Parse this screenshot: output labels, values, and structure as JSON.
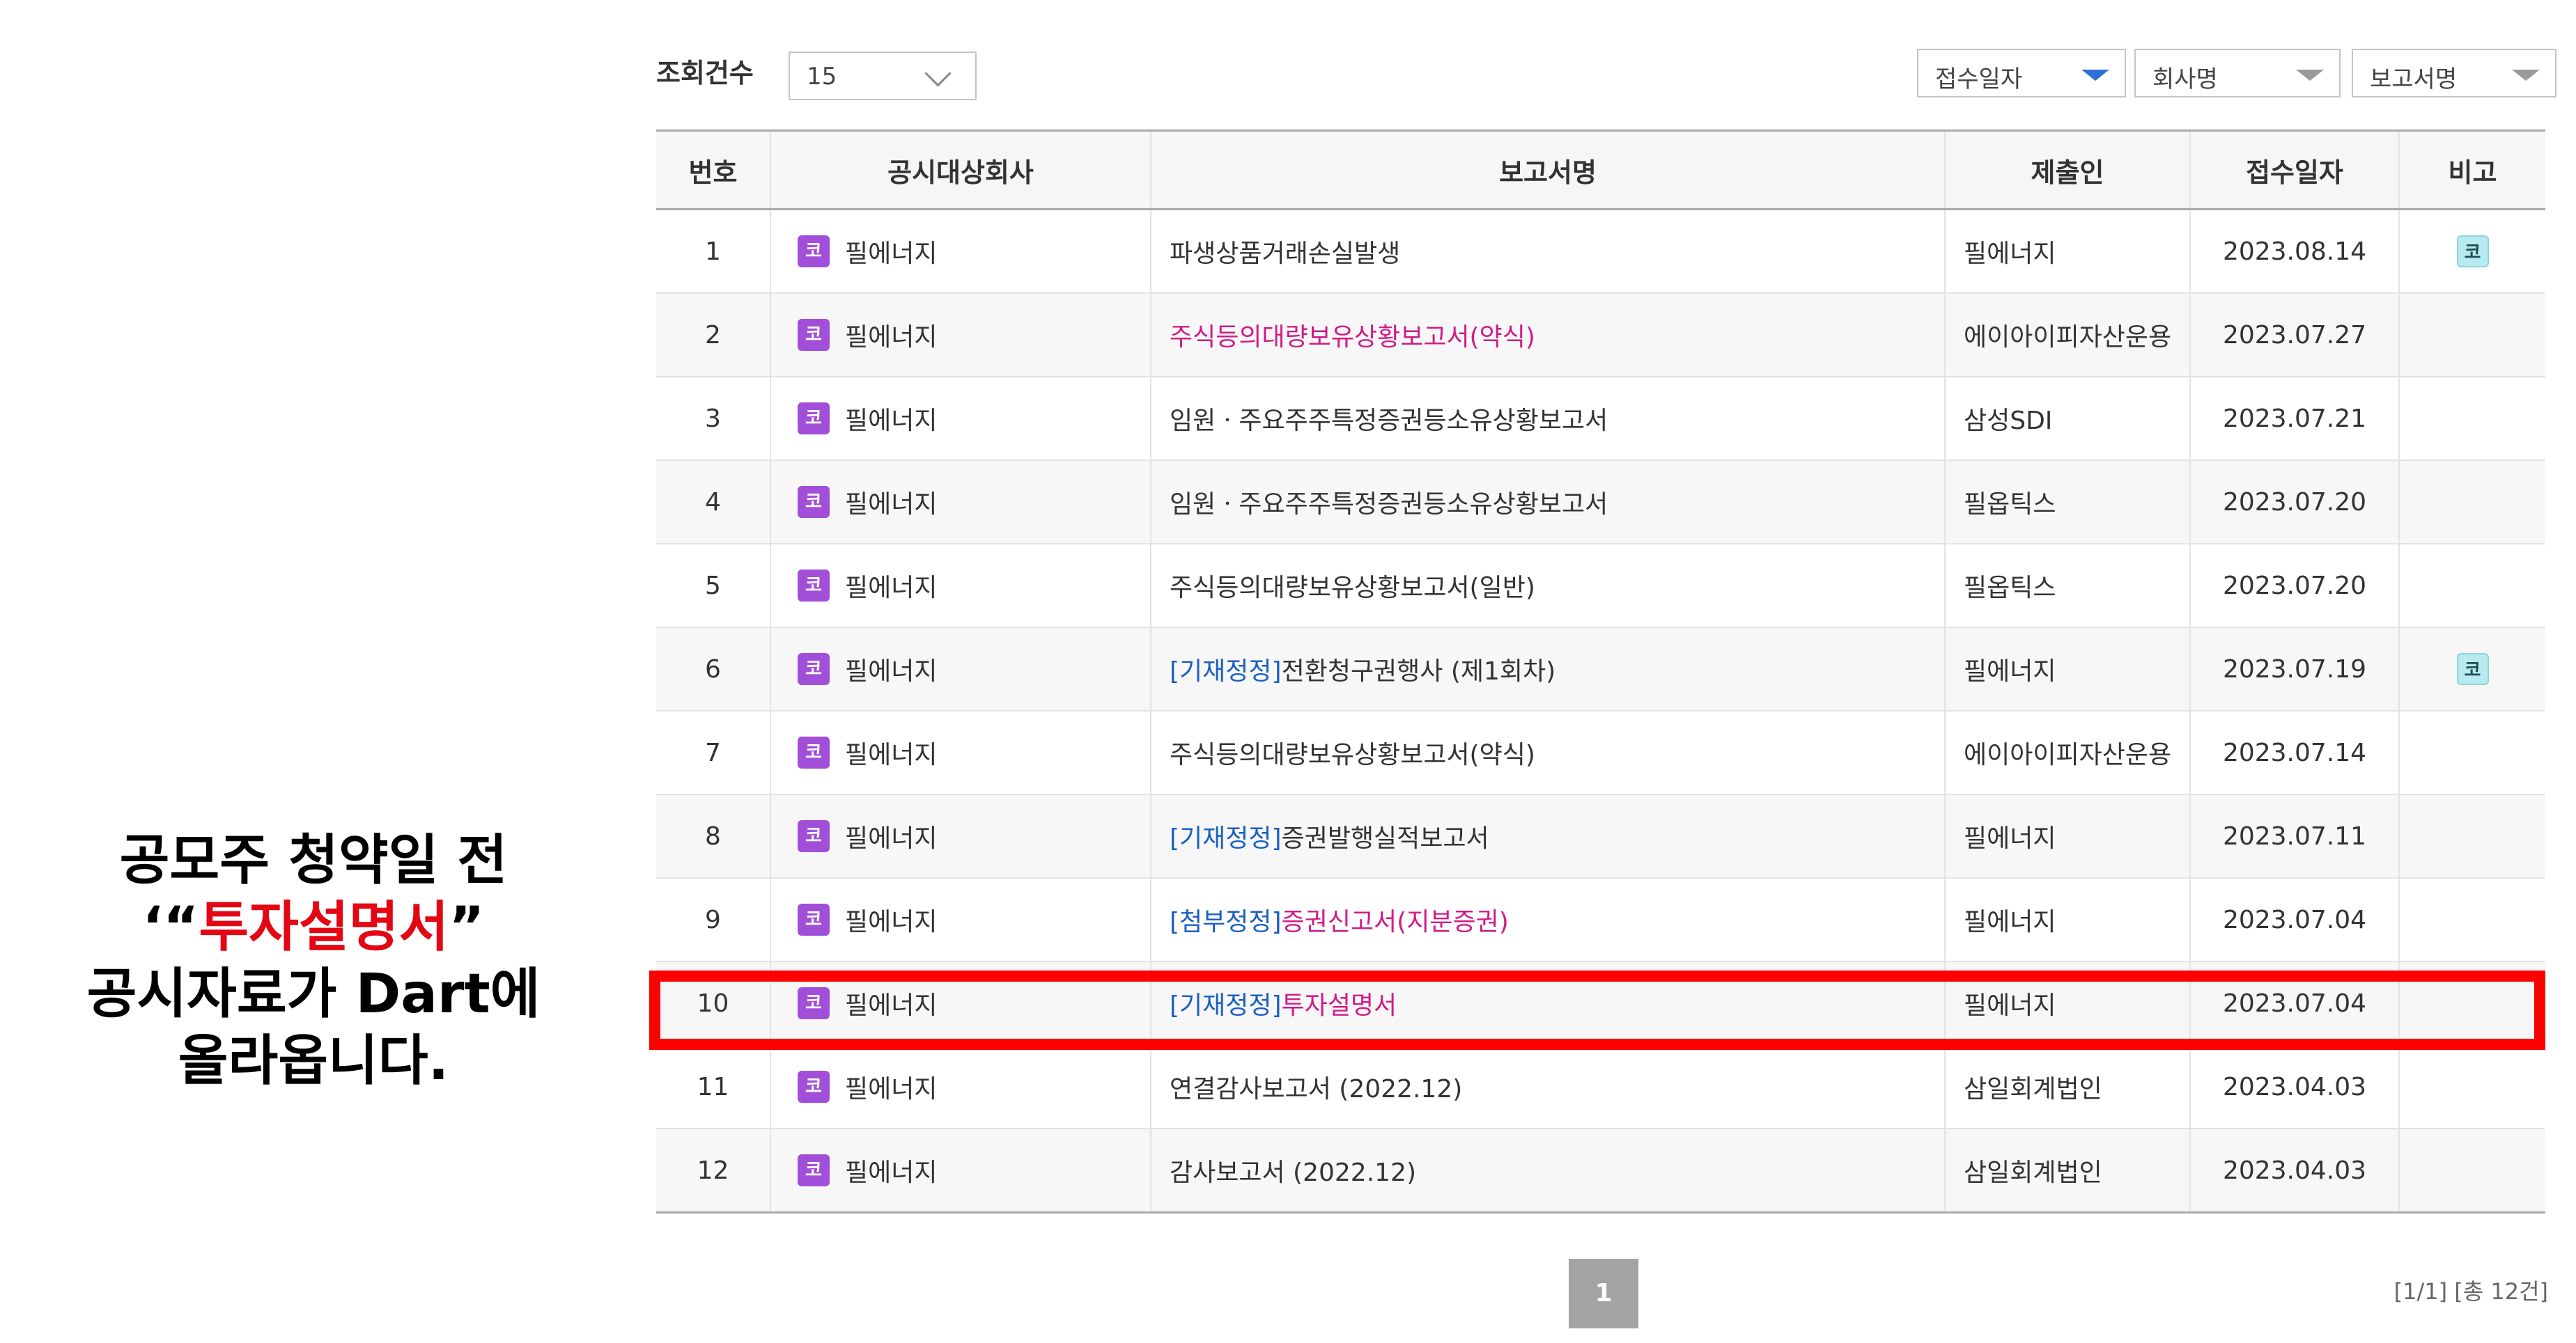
{
  "caption": {
    "line1": "공모주 청약일 전",
    "line2_open": "‘“",
    "line2_highlight": "투자설명서",
    "line2_close": "”",
    "line3": "공시자료가 Dart에",
    "line4": "올라옵니다."
  },
  "toolbar": {
    "count_label": "조회건수",
    "count_value": "15",
    "sort_date": "접수일자",
    "sort_company": "회사명",
    "sort_report": "보고서명"
  },
  "colors": {
    "highlight_box": "#ff0000",
    "caption_highlight": "#e30613",
    "link_blue": "#1a5fc3",
    "link_pink": "#d01b88",
    "badge_purple": "#a14fd8",
    "badge_teal": "#b6ecef",
    "sort_active": "#2f6fd6"
  },
  "table": {
    "headers": [
      "번호",
      "공시대상회사",
      "보고서명",
      "제출인",
      "접수일자",
      "비고"
    ],
    "rows": [
      {
        "no": "1",
        "badge": "코",
        "company": "필에너지",
        "report_prefix": "",
        "report": "파생상품거래손실발생",
        "report_color": "default",
        "submitter": "필에너지",
        "date": "2023.08.14",
        "note_badge": "코"
      },
      {
        "no": "2",
        "badge": "코",
        "company": "필에너지",
        "report_prefix": "",
        "report": "주식등의대량보유상황보고서(약식)",
        "report_color": "pink",
        "submitter": "에이아이피자산운용",
        "date": "2023.07.27",
        "note_badge": ""
      },
      {
        "no": "3",
        "badge": "코",
        "company": "필에너지",
        "report_prefix": "",
        "report": "임원ㆍ주요주주특정증권등소유상황보고서",
        "report_color": "default",
        "submitter": "삼성SDI",
        "date": "2023.07.21",
        "note_badge": ""
      },
      {
        "no": "4",
        "badge": "코",
        "company": "필에너지",
        "report_prefix": "",
        "report": "임원ㆍ주요주주특정증권등소유상황보고서",
        "report_color": "default",
        "submitter": "필옵틱스",
        "date": "2023.07.20",
        "note_badge": ""
      },
      {
        "no": "5",
        "badge": "코",
        "company": "필에너지",
        "report_prefix": "",
        "report": "주식등의대량보유상황보고서(일반)",
        "report_color": "default",
        "submitter": "필옵틱스",
        "date": "2023.07.20",
        "note_badge": ""
      },
      {
        "no": "6",
        "badge": "코",
        "company": "필에너지",
        "report_prefix": "[기재정정]",
        "report": "전환청구권행사 (제1회차)",
        "report_color": "default",
        "submitter": "필에너지",
        "date": "2023.07.19",
        "note_badge": "코"
      },
      {
        "no": "7",
        "badge": "코",
        "company": "필에너지",
        "report_prefix": "",
        "report": "주식등의대량보유상황보고서(약식)",
        "report_color": "default",
        "submitter": "에이아이피자산운용",
        "date": "2023.07.14",
        "note_badge": ""
      },
      {
        "no": "8",
        "badge": "코",
        "company": "필에너지",
        "report_prefix": "[기재정정]",
        "report": "증권발행실적보고서",
        "report_color": "default",
        "submitter": "필에너지",
        "date": "2023.07.11",
        "note_badge": ""
      },
      {
        "no": "9",
        "badge": "코",
        "company": "필에너지",
        "report_prefix": "[첨부정정]",
        "report": "증권신고서(지분증권)",
        "report_color": "pink",
        "submitter": "필에너지",
        "date": "2023.07.04",
        "note_badge": ""
      },
      {
        "no": "10",
        "badge": "코",
        "company": "필에너지",
        "report_prefix": "[기재정정]",
        "report": "투자설명서",
        "report_color": "pink",
        "submitter": "필에너지",
        "date": "2023.07.04",
        "note_badge": ""
      },
      {
        "no": "11",
        "badge": "코",
        "company": "필에너지",
        "report_prefix": "",
        "report": "연결감사보고서 (2022.12)",
        "report_color": "default",
        "submitter": "삼일회계법인",
        "date": "2023.04.03",
        "note_badge": ""
      },
      {
        "no": "12",
        "badge": "코",
        "company": "필에너지",
        "report_prefix": "",
        "report": "감사보고서 (2022.12)",
        "report_color": "default",
        "submitter": "삼일회계법인",
        "date": "2023.04.03",
        "note_badge": ""
      }
    ]
  },
  "pagination": {
    "current_page": "1",
    "info": "[1/1] [총 12건]"
  }
}
